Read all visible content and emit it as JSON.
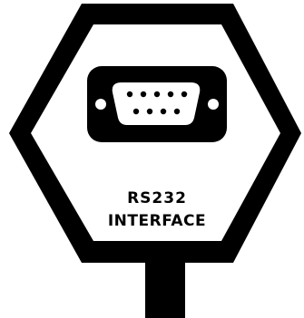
{
  "sign": {
    "label_line1": "RS232",
    "label_line2": "INTERFACE",
    "icon": "db9-serial-connector-icon",
    "colors": {
      "ink": "#000000",
      "paper": "#ffffff"
    }
  }
}
